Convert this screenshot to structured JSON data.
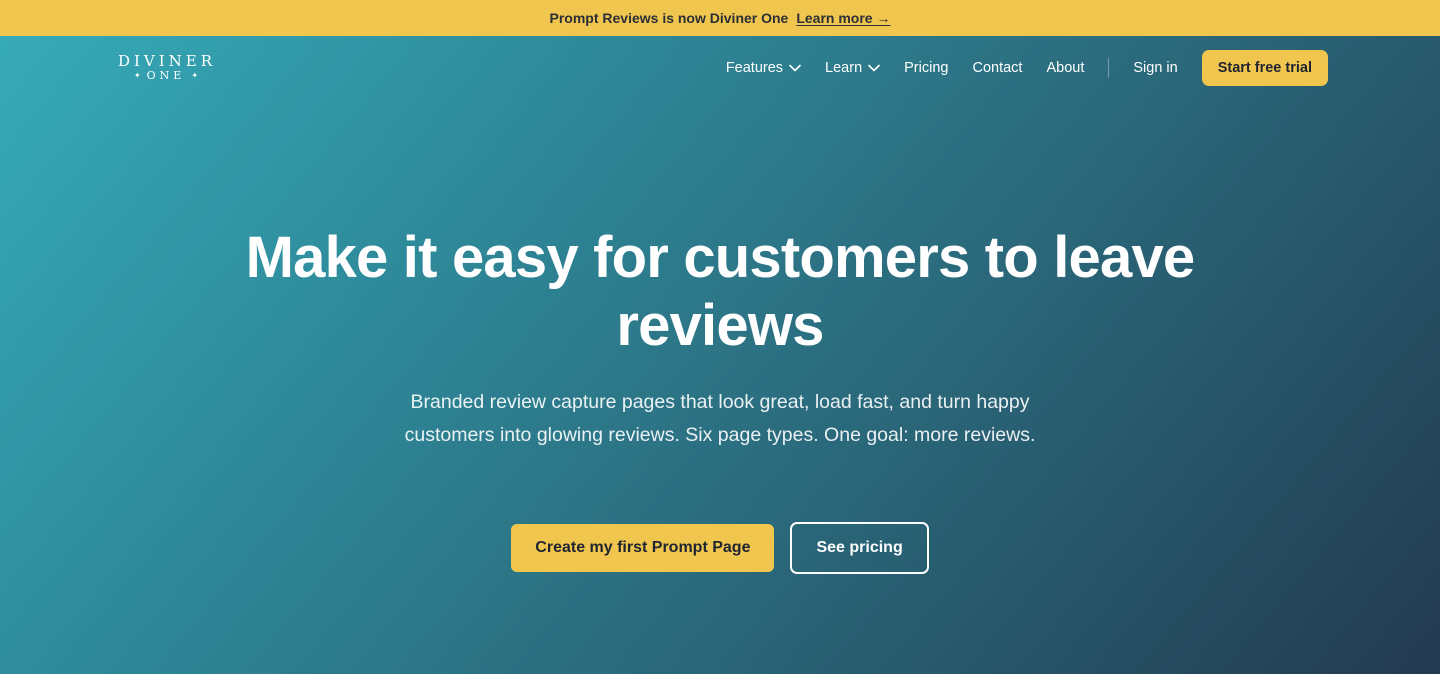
{
  "announcement": {
    "text": "Prompt Reviews is now Diviner One",
    "link_label": "Learn more →"
  },
  "logo": {
    "line1": "DIVINER",
    "line2": "ONE",
    "star": "✦"
  },
  "nav": {
    "items": [
      {
        "label": "Features",
        "has_dropdown": true
      },
      {
        "label": "Learn",
        "has_dropdown": true
      },
      {
        "label": "Pricing"
      },
      {
        "label": "Contact"
      },
      {
        "label": "About"
      }
    ],
    "signin_label": "Sign in",
    "trial_label": "Start free trial"
  },
  "hero": {
    "headline": "Make it easy for customers to leave reviews",
    "subhead": "Branded review capture pages that look great, load fast, and turn happy customers into glowing reviews. Six page types. One goal: more reviews.",
    "primary_cta": "Create my first Prompt Page",
    "secondary_cta": "See pricing"
  },
  "colors": {
    "accent": "#f0c64e",
    "gradient_start": "#36aab8",
    "gradient_end": "#233a50",
    "text_dark": "#1f2530"
  },
  "icons": {
    "dropdown": "chevron-down-icon"
  }
}
